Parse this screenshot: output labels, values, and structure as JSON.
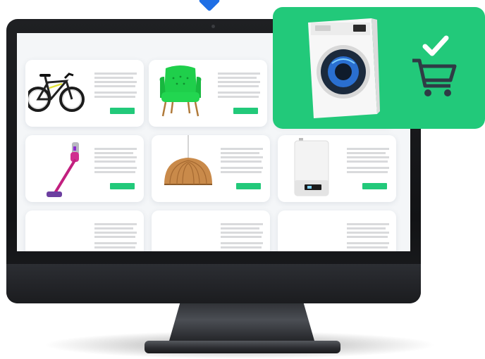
{
  "colors": {
    "accent_green": "#22c97a",
    "pointer_blue": "#1f6fe5",
    "monitor_dark": "#1b1c1f",
    "screen_bg": "#f4f6f8",
    "cart_icon": "#2f3b45"
  },
  "screen": {
    "products": [
      {
        "icon": "bicycle-icon",
        "has_button": true
      },
      {
        "icon": "armchair-icon",
        "has_button": true
      },
      {
        "icon": "vacuum-cleaner-icon",
        "has_button": true
      },
      {
        "icon": "pendant-lamp-icon",
        "has_button": true
      },
      {
        "icon": "boiler-icon",
        "has_button": true
      },
      {
        "icon": "placeholder",
        "has_button": false
      },
      {
        "icon": "placeholder",
        "has_button": false
      },
      {
        "icon": "placeholder",
        "has_button": false
      }
    ]
  },
  "highlight": {
    "product_icon": "washing-machine-icon",
    "action_icon": "cart-check-icon"
  }
}
